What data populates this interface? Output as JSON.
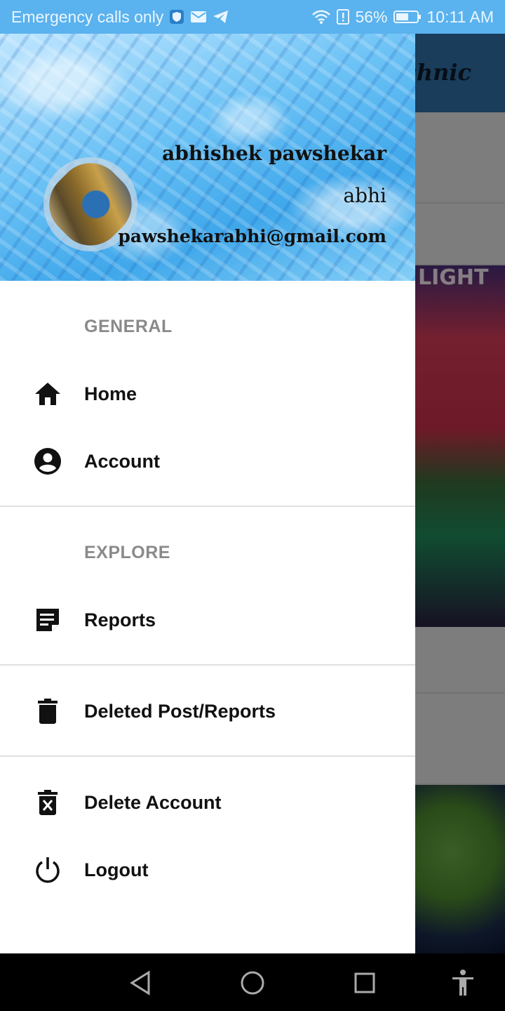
{
  "status_bar": {
    "carrier_text": "Emergency calls only",
    "battery_percent": "56%",
    "time": "10:11 AM",
    "icons": [
      "shield-icon",
      "mail-icon",
      "telegram-icon",
      "wifi-icon",
      "alert-icon",
      "battery-icon"
    ]
  },
  "background_app": {
    "title": "echnic",
    "photo_text": "LIGHT"
  },
  "drawer": {
    "header": {
      "name": "abhishek pawshekar",
      "nickname": "abhi",
      "email": "pawshekarabhi@gmail.com"
    },
    "sections": [
      {
        "title": "GENERAL",
        "items": [
          {
            "label": "Home",
            "icon": "home-icon"
          },
          {
            "label": "Account",
            "icon": "account-circle-icon"
          }
        ]
      },
      {
        "title": "EXPLORE",
        "items": [
          {
            "label": "Reports",
            "icon": "note-icon"
          }
        ]
      }
    ],
    "extra_items": [
      {
        "label": "Deleted Post/Reports",
        "icon": "trash-icon"
      },
      {
        "label": "Delete Account",
        "icon": "delete-x-icon"
      },
      {
        "label": "Logout",
        "icon": "power-icon"
      }
    ]
  },
  "nav_bar": {
    "buttons": [
      "back-icon",
      "home-circle-icon",
      "recents-icon",
      "accessibility-icon"
    ]
  }
}
